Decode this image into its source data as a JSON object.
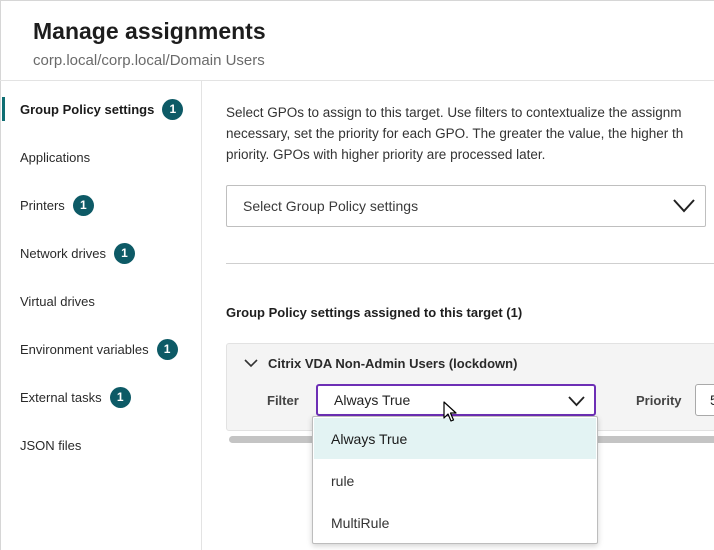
{
  "header": {
    "title": "Manage assignments",
    "subtitle": "corp.local/corp.local/Domain Users"
  },
  "sidebar": {
    "items": [
      {
        "label": "Group Policy settings",
        "badge": "1",
        "active": true
      },
      {
        "label": "Applications"
      },
      {
        "label": "Printers",
        "badge": "1"
      },
      {
        "label": "Network drives",
        "badge": "1"
      },
      {
        "label": "Virtual drives"
      },
      {
        "label": "Environment variables",
        "badge": "1"
      },
      {
        "label": "External tasks",
        "badge": "1"
      },
      {
        "label": "JSON files"
      }
    ]
  },
  "main": {
    "description_lines": [
      "Select GPOs to assign to this target. Use filters to contextualize the assignm",
      "necessary, set the priority for each GPO. The greater the value, the higher th",
      "priority. GPOs with higher priority are processed later."
    ],
    "gpo_select_placeholder": "Select Group Policy settings",
    "assigned_title": "Group Policy settings assigned to this target (1)",
    "card": {
      "title": "Citrix VDA Non-Admin Users (lockdown)",
      "filter_label": "Filter",
      "filter_value": "Always True",
      "priority_label": "Priority",
      "priority_value": "5"
    },
    "dropdown_options": [
      "Always True",
      "rule",
      "MultiRule"
    ]
  },
  "colors": {
    "accent_teal": "#0d5a66",
    "focus_purple": "#6d2fb5",
    "option_highlight": "#e3f3f3"
  }
}
